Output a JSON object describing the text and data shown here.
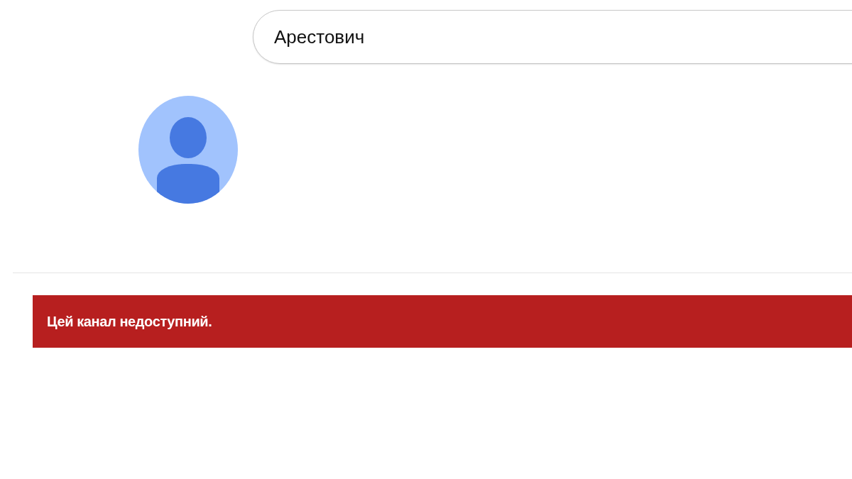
{
  "search": {
    "value": "Арестович"
  },
  "notice": {
    "message": "Цей канал недоступний."
  }
}
